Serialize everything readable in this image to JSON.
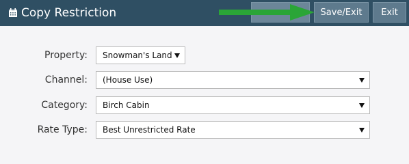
{
  "header": {
    "title": "Copy Restriction",
    "hidden_button_label": "",
    "save_exit_label": "Save/Exit",
    "exit_label": "Exit",
    "calendar_icon": "calendar-icon",
    "arrow_color": "#2aa537"
  },
  "form": {
    "fields": [
      {
        "label": "Property:",
        "value": "Snowman's Land"
      },
      {
        "label": "Channel:",
        "value": "(House Use)"
      },
      {
        "label": "Category:",
        "value": "Birch Cabin"
      },
      {
        "label": "Rate Type:",
        "value": "Best Unrestricted Rate"
      }
    ]
  },
  "colors": {
    "header_bg": "#2f4f63",
    "button_bg": "#5e7a8d",
    "page_bg": "#f5f5f7"
  }
}
